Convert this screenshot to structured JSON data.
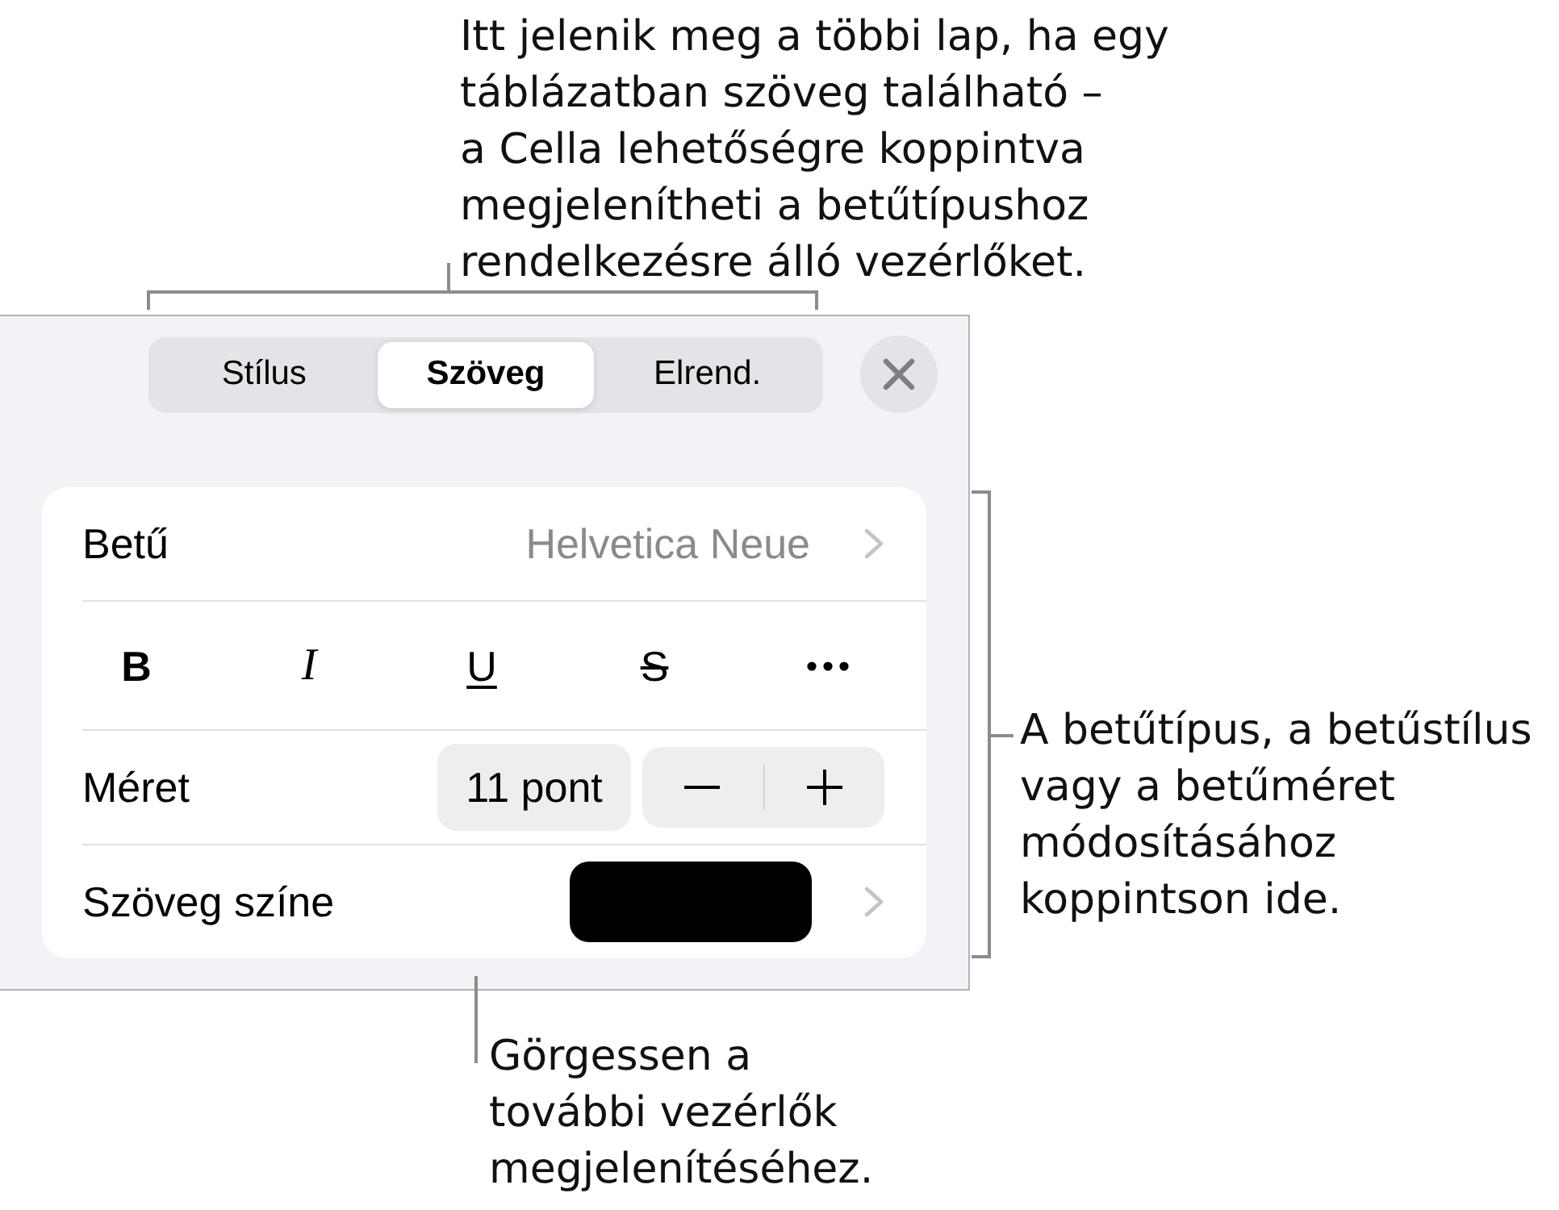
{
  "top_note": {
    "lines": [
      "Itt jelenik meg a többi lap, ha egy",
      "táblázatban szöveg található –",
      "a Cella lehetőségre koppintva",
      "megjelenítheti a betűtípushoz",
      "rendelkezésre álló vezérlőket."
    ]
  },
  "inspector": {
    "tabs": [
      {
        "label": "Stílus",
        "selected": false
      },
      {
        "label": "Szöveg",
        "selected": true
      },
      {
        "label": "Elrend.",
        "selected": false
      }
    ],
    "font_row": {
      "label": "Betű",
      "value": "Helvetica Neue"
    },
    "style_buttons": [
      {
        "kind": "bold",
        "label": "B"
      },
      {
        "kind": "italic",
        "label": "I"
      },
      {
        "kind": "underline",
        "label": "U"
      },
      {
        "kind": "strikethrough",
        "label": "S"
      },
      {
        "kind": "more"
      }
    ],
    "size_row": {
      "label": "Méret",
      "value": "11 pont"
    },
    "color_row": {
      "label": "Szöveg színe",
      "color": "#000000"
    }
  },
  "side_note": {
    "lines": [
      "A betűtípus, a betűstílus",
      "vagy a betűméret",
      "módosításához",
      "koppintson ide."
    ]
  },
  "bottom_note": {
    "lines": [
      "Görgessen a",
      "további vezérlők",
      "megjelenítéséhez."
    ]
  }
}
